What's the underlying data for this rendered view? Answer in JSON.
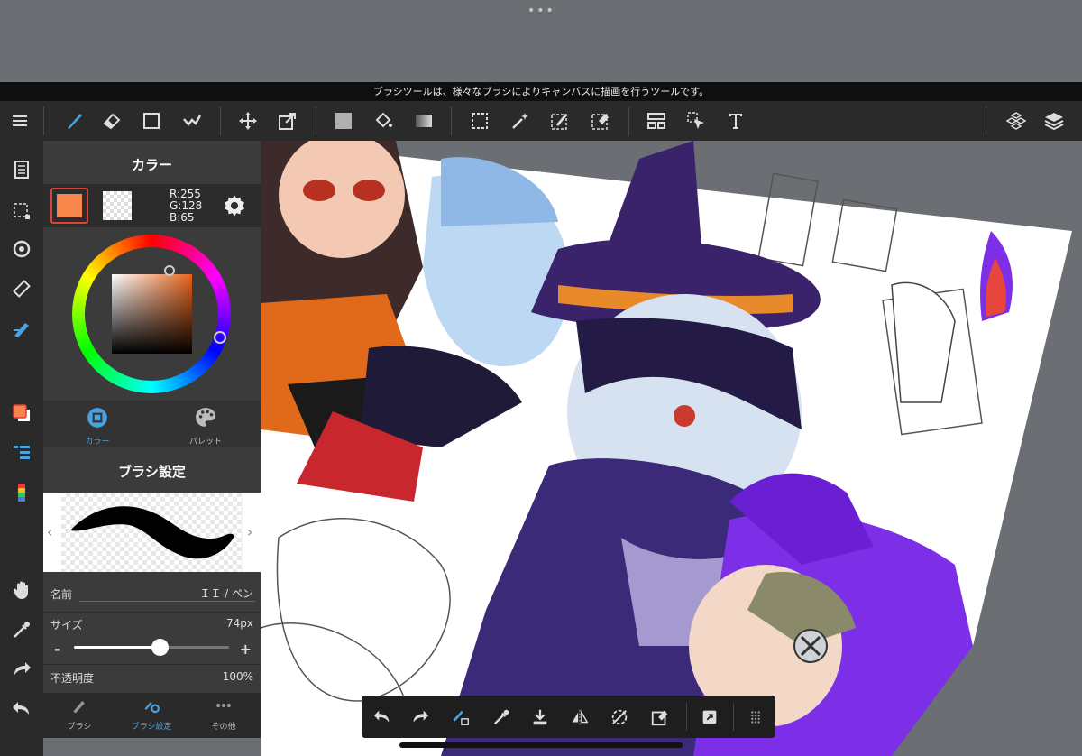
{
  "status_tip": "ブラシツールは、様々なブラシによりキャンバスに描画を行うツールです。",
  "color_panel": {
    "title": "カラー",
    "rgb": {
      "r": "R:255",
      "g": "G:128",
      "b": "B:65"
    },
    "main_color": "#f6864a",
    "tabs": [
      {
        "label": "カラー",
        "active": true
      },
      {
        "label": "パレット",
        "active": false
      }
    ]
  },
  "brush_panel": {
    "title": "ブラシ設定",
    "name_label": "名前",
    "name_value": "ＩＩ / ペン",
    "size_label": "サイズ",
    "size_value": "74px",
    "size_fraction": 0.55,
    "opacity_label": "不透明度",
    "opacity_value": "100%",
    "minus": "-",
    "plus": "+"
  },
  "bottom_tabs": [
    {
      "label": "ブラシ",
      "active": false
    },
    {
      "label": "ブラシ設定",
      "active": true
    },
    {
      "label": "その他",
      "active": false
    }
  ],
  "toolbar_icons": [
    "menu-icon",
    "brush-icon",
    "eraser-icon",
    "rectangle-icon",
    "fill-brush-icon",
    "move-icon",
    "transform-icon",
    "color-fill-icon",
    "bucket-icon",
    "gradient-icon",
    "select-rect-icon",
    "magic-wand-icon",
    "select-pen-icon",
    "select-eraser-icon",
    "panel-icon",
    "select-move-icon",
    "text-icon",
    "3d-material-icon",
    "layers-icon"
  ],
  "accent_color": "#4aa3df"
}
